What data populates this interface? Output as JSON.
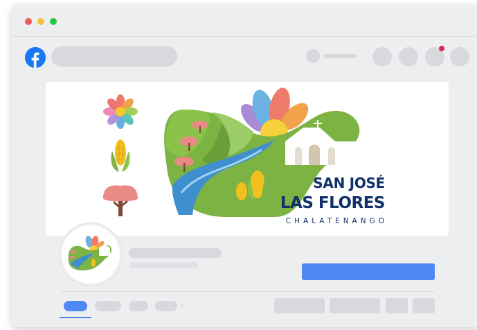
{
  "browser": {
    "window_controls": [
      "close",
      "minimize",
      "maximize"
    ]
  },
  "header": {
    "logo_icon": "facebook-logo-icon",
    "has_notification": true
  },
  "cover": {
    "logo": {
      "line1": "SAN JOSÉ",
      "line2": "LAS FLORES",
      "line3": "CHALATENANGO"
    },
    "icons": [
      "flower-icon",
      "corn-icon",
      "tree-icon"
    ]
  },
  "colors": {
    "facebook_blue": "#1877f2",
    "accent_blue": "#4e88f5",
    "placeholder_gray": "#d7d9dc",
    "logo_navy": "#10306a",
    "notification_red": "#e0245e"
  }
}
